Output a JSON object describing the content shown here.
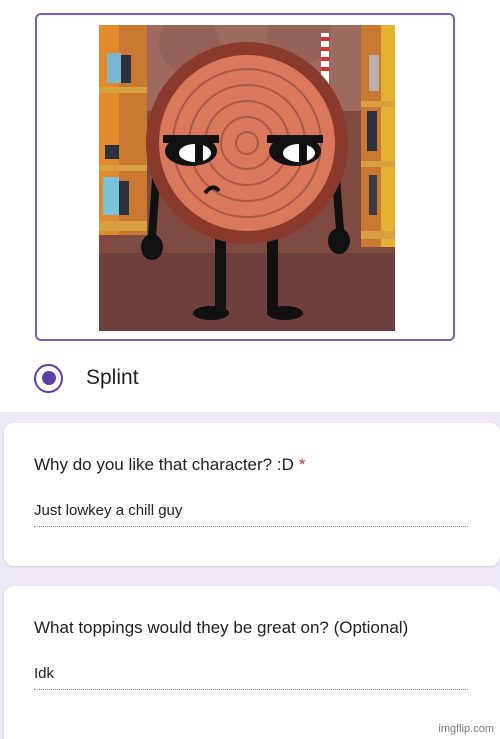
{
  "choice": {
    "label": "Splint",
    "selected": true
  },
  "question_1": {
    "title": "Why do you like that character? :D",
    "required_marker": "*",
    "answer": "Just lowkey a chill guy"
  },
  "question_2": {
    "title": "What toppings would they be great on? (Optional)",
    "answer": "Idk"
  },
  "watermark": "imgflip.com",
  "colors": {
    "accent": "#5b3ea6",
    "background": "#ede9f6",
    "required": "#d93025"
  }
}
